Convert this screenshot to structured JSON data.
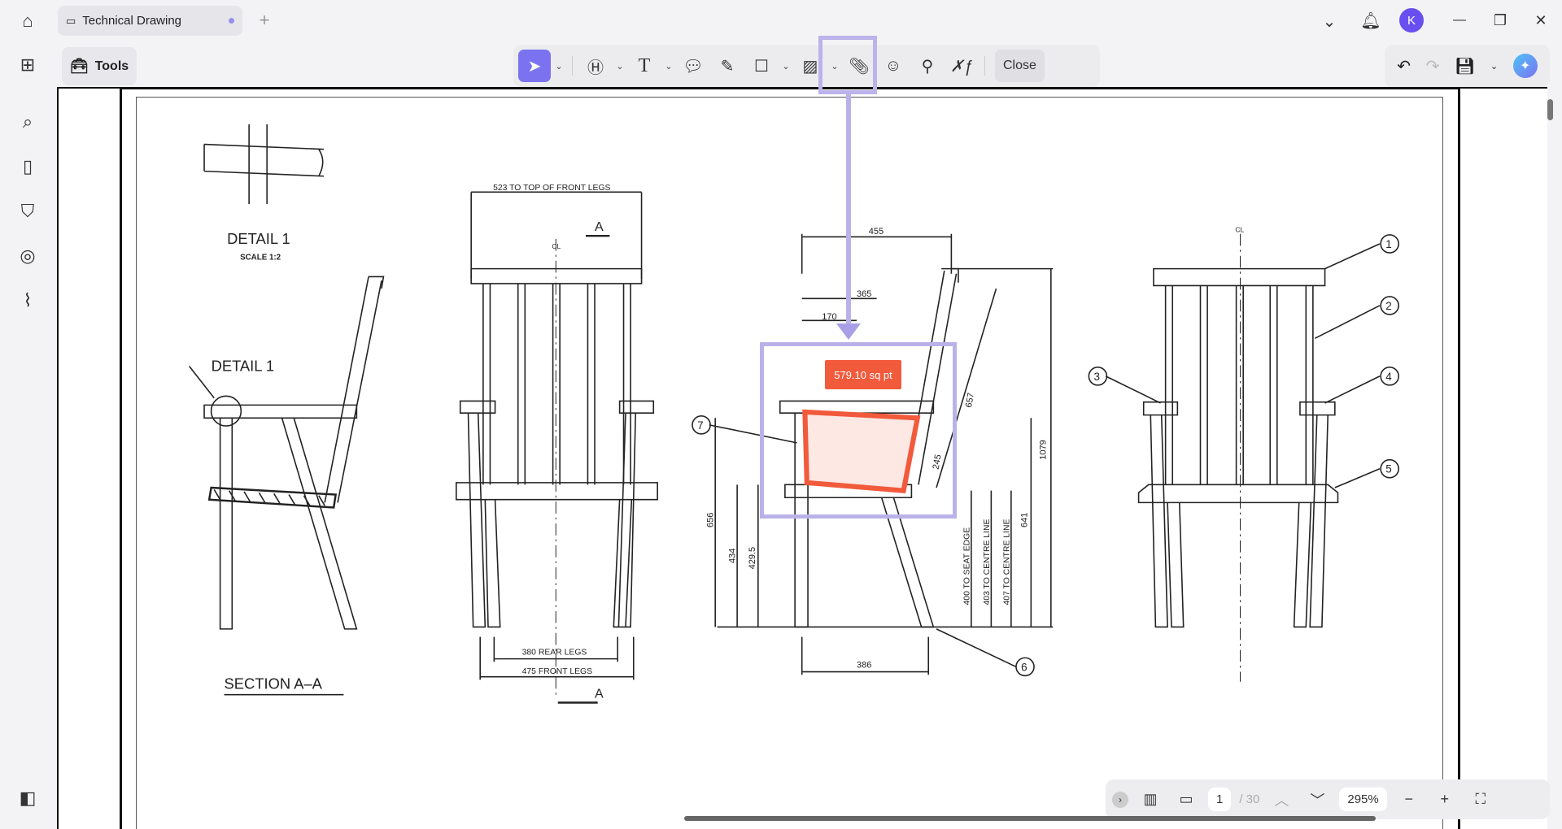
{
  "tab": {
    "title": "Technical Drawing",
    "new_tab": "+"
  },
  "window": {
    "minimize": "—",
    "restore": "❐",
    "close": "✕",
    "dropdown": "⌄",
    "avatar": "K"
  },
  "tools_label": "Tools",
  "toolbar": {
    "close_label": "Close"
  },
  "measurement": "579.10 sq pt",
  "pager": {
    "current": "1",
    "total": "/ 30",
    "zoom": "295%"
  },
  "drawing": {
    "detail_title": "DETAIL 1",
    "detail_scale": "SCALE 1:2",
    "detail_callout": "DETAIL 1",
    "section": "SECTION A–A",
    "dim_top_front": "523 TO TOP OF FRONT LEGS",
    "section_mark": "A",
    "cl": "CL",
    "rear_legs": "380 REAR LEGS",
    "front_legs": "475 FRONT LEGS",
    "d455": "455",
    "d365": "365",
    "d170": "170",
    "d657": "657",
    "d1079": "1079",
    "d245": "245",
    "d656": "656",
    "d434": "434",
    "d4295": "429.5",
    "seat_edge": "400 TO SEAT EDGE",
    "centre1": "403 TO CENTRE LINE",
    "centre2": "407 TO CENTRE LINE",
    "d641": "641",
    "d386": "386",
    "callouts": [
      "1",
      "2",
      "3",
      "4",
      "5",
      "6",
      "7"
    ]
  }
}
